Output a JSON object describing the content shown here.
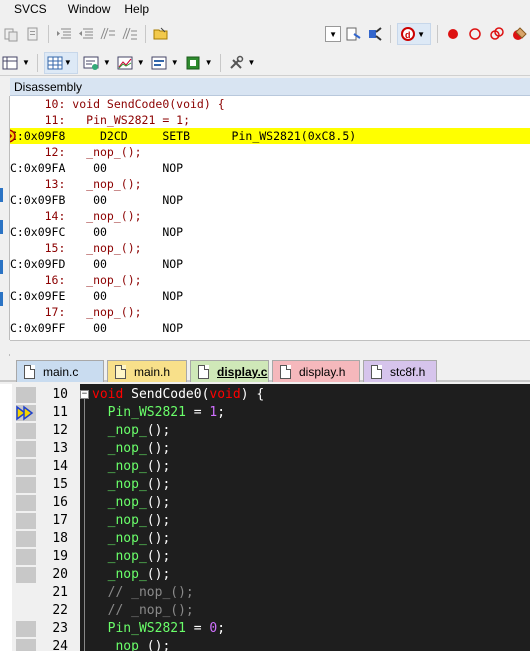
{
  "menu": {
    "items": [
      "SVCS",
      "Window",
      "Help"
    ]
  },
  "disassembly": {
    "title": "Disassembly",
    "lines": [
      {
        "kind": "src",
        "text": "     10: void SendCode0(void) {"
      },
      {
        "kind": "src",
        "text": "     11:   Pin_WS2821 = 1;"
      },
      {
        "kind": "asm",
        "text": "C:0x09F8     D2CD     SETB      Pin_WS2821(0xC8.5)",
        "current": true
      },
      {
        "kind": "src",
        "text": "     12:   _nop_();"
      },
      {
        "kind": "asm",
        "text": "C:0x09FA    00        NOP"
      },
      {
        "kind": "src",
        "text": "     13:   _nop_();"
      },
      {
        "kind": "asm",
        "text": "C:0x09FB    00        NOP"
      },
      {
        "kind": "src",
        "text": "     14:   _nop_();"
      },
      {
        "kind": "asm",
        "text": "C:0x09FC    00        NOP"
      },
      {
        "kind": "src",
        "text": "     15:   _nop_();"
      },
      {
        "kind": "asm",
        "text": "C:0x09FD    00        NOP"
      },
      {
        "kind": "src",
        "text": "     16:   _nop_();"
      },
      {
        "kind": "asm",
        "text": "C:0x09FE    00        NOP"
      },
      {
        "kind": "src",
        "text": "     17:   _nop_();"
      },
      {
        "kind": "asm",
        "text": "C:0x09FF    00        NOP"
      }
    ]
  },
  "tabs": [
    {
      "label": "main.c",
      "color": "#c9dcf0",
      "icon_color": "#ffffff",
      "active": false
    },
    {
      "label": "main.h",
      "color": "#f8e08a",
      "icon_color": "#fff6c8",
      "active": false
    },
    {
      "label": "display.c",
      "color": "#cfe8b8",
      "icon_color": "#ffffff",
      "active": true
    },
    {
      "label": "display.h",
      "color": "#f5b8bc",
      "icon_color": "#ffffff",
      "active": false
    },
    {
      "label": "stc8f.h",
      "color": "#d6c4ec",
      "icon_color": "#ffffff",
      "active": false
    }
  ],
  "editor": {
    "lines": [
      {
        "num": "10",
        "tokens": [
          [
            "kw",
            "void"
          ],
          [
            "op",
            " SendCode0("
          ],
          [
            "kw",
            "void"
          ],
          [
            "op",
            ") {"
          ]
        ],
        "fold": true
      },
      {
        "num": "11",
        "tokens": [
          [
            "op",
            "  "
          ],
          [
            "ident",
            "Pin_WS2821"
          ],
          [
            "op",
            " = "
          ],
          [
            "num",
            "1"
          ],
          [
            "op",
            ";"
          ]
        ],
        "current": true
      },
      {
        "num": "12",
        "tokens": [
          [
            "op",
            "  "
          ],
          [
            "ident",
            "_nop_"
          ],
          [
            "op",
            "();"
          ]
        ]
      },
      {
        "num": "13",
        "tokens": [
          [
            "op",
            "  "
          ],
          [
            "ident",
            "_nop_"
          ],
          [
            "op",
            "();"
          ]
        ]
      },
      {
        "num": "14",
        "tokens": [
          [
            "op",
            "  "
          ],
          [
            "ident",
            "_nop_"
          ],
          [
            "op",
            "();"
          ]
        ]
      },
      {
        "num": "15",
        "tokens": [
          [
            "op",
            "  "
          ],
          [
            "ident",
            "_nop_"
          ],
          [
            "op",
            "();"
          ]
        ]
      },
      {
        "num": "16",
        "tokens": [
          [
            "op",
            "  "
          ],
          [
            "ident",
            "_nop_"
          ],
          [
            "op",
            "();"
          ]
        ]
      },
      {
        "num": "17",
        "tokens": [
          [
            "op",
            "  "
          ],
          [
            "ident",
            "_nop_"
          ],
          [
            "op",
            "();"
          ]
        ]
      },
      {
        "num": "18",
        "tokens": [
          [
            "op",
            "  "
          ],
          [
            "ident",
            "_nop_"
          ],
          [
            "op",
            "();"
          ]
        ]
      },
      {
        "num": "19",
        "tokens": [
          [
            "op",
            "  "
          ],
          [
            "ident",
            "_nop_"
          ],
          [
            "op",
            "();"
          ]
        ]
      },
      {
        "num": "20",
        "tokens": [
          [
            "op",
            "  "
          ],
          [
            "ident",
            "_nop_"
          ],
          [
            "op",
            "();"
          ]
        ]
      },
      {
        "num": "21",
        "tokens": [
          [
            "comment",
            "  // _nop_();"
          ]
        ],
        "nomark": true
      },
      {
        "num": "22",
        "tokens": [
          [
            "comment",
            "  // _nop_();"
          ]
        ],
        "nomark": true
      },
      {
        "num": "23",
        "tokens": [
          [
            "op",
            "  "
          ],
          [
            "ident",
            "Pin_WS2821"
          ],
          [
            "op",
            " = "
          ],
          [
            "num",
            "0"
          ],
          [
            "op",
            ";"
          ]
        ]
      },
      {
        "num": "24",
        "tokens": [
          [
            "op",
            "  "
          ],
          [
            "ident",
            "_nop_"
          ],
          [
            "op",
            "();"
          ]
        ]
      }
    ]
  },
  "toolbar": {
    "icons1": [
      "cut-icon",
      "copy-icon",
      "paste-icon",
      "indent-icon",
      "outdent-icon",
      "comment-icon",
      "uncomment-icon",
      "open-file-icon"
    ],
    "icons1_right": [
      "combo-box",
      "insert-icon",
      "debug-icon",
      "debug-start-icon",
      "breakpoint-icon",
      "breakpoint-off-icon",
      "breakpoints-icon",
      "kill-breakpoints-icon"
    ]
  }
}
